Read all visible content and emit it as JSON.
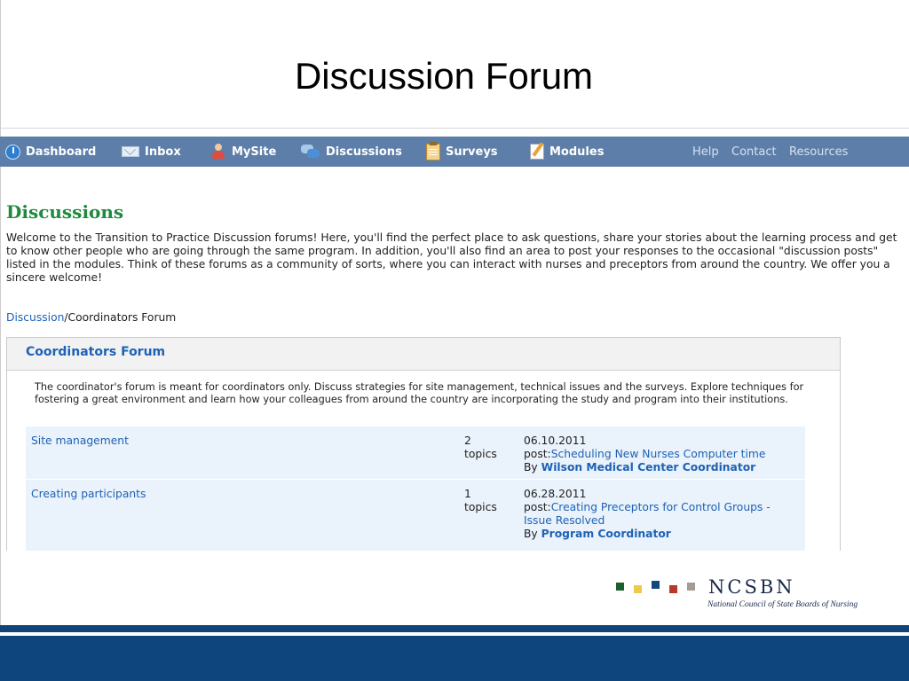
{
  "slide": {
    "title": "Discussion Forum"
  },
  "nav": {
    "items": [
      {
        "label": "Dashboard",
        "icon": "power-icon"
      },
      {
        "label": "Inbox",
        "icon": "mail-icon"
      },
      {
        "label": "MySite",
        "icon": "person-icon"
      },
      {
        "label": "Discussions",
        "icon": "chat-bubbles-icon"
      },
      {
        "label": "Surveys",
        "icon": "clipboard-icon"
      },
      {
        "label": "Modules",
        "icon": "notepad-icon"
      }
    ],
    "utility": [
      "Help",
      "Contact",
      "Resources"
    ]
  },
  "page": {
    "heading": "Discussions",
    "intro": "Welcome to the Transition to Practice Discussion forums! Here, you'll find the perfect place to ask questions, share your stories about the learning process and get to know other people who are going through the same program. In addition, you'll also find an area to post your responses to the occasional \"discussion posts\" listed in the modules. Think of these forums as a community of sorts, where you can interact with nurses and preceptors from around the country. We offer you a sincere welcome!",
    "breadcrumb": {
      "link": "Discussion",
      "rest": "/Coordinators Forum"
    }
  },
  "forum": {
    "title": "Coordinators Forum",
    "description": "The coordinator's forum is meant for coordinators only. Discuss strategies for site management, technical issues and the surveys. Explore techniques for fostering a great environment and learn how your colleagues from around the country are incorporating the study and program into their institutions.",
    "topics": [
      {
        "name": "Site management",
        "count": "2",
        "count_label": "topics",
        "date": "06.10.2011",
        "post_prefix": "post:",
        "post_title": "Scheduling New Nurses Computer time",
        "by_prefix": "By ",
        "author": "Wilson Medical Center Coordinator"
      },
      {
        "name": "Creating participants",
        "count": "1",
        "count_label": "topics",
        "date": "06.28.2011",
        "post_prefix": "post:",
        "post_title": "Creating Preceptors for Control Groups - Issue Resolved",
        "by_prefix": "By ",
        "author": "Program Coordinator"
      }
    ]
  },
  "logo": {
    "name": "NCSBN",
    "tagline": "National Council of State Boards of Nursing",
    "square_colors": [
      "#1e5e2c",
      "#f2c84b",
      "#16467e",
      "#b43a2e",
      "#a39c95"
    ]
  },
  "colors": {
    "nav_bar": "#5d7ea8",
    "heading_green": "#1f8a3d",
    "link_blue": "#1d62b5",
    "row_bg": "#eaf2fb",
    "footer_navy": "#0e457d"
  }
}
